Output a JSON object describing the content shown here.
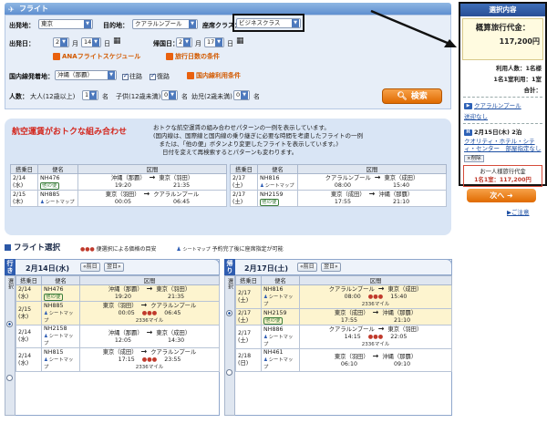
{
  "header": {
    "title": "フライト"
  },
  "search": {
    "departure_label": "出発地：",
    "departure_value": "東京",
    "destination_label": "目的地：",
    "destination_value": "クアラルンプール",
    "class_label": "座席クラス：",
    "class_value": "ビジネスクラス",
    "depart_date_label": "出発日：",
    "depart_month": "2",
    "depart_month_unit": "月",
    "depart_day": "14",
    "depart_day_unit": "日",
    "return_date_label": "帰国日：",
    "return_month": "2",
    "return_month_unit": "月",
    "return_day": "17",
    "return_day_unit": "日",
    "schedule_link": "ANAフライトスケジュール",
    "days_condition_link": "旅行日数の条件",
    "domestic_label": "国内線発着地：",
    "domestic_value": "沖縄（那覇）",
    "outbound_check": "往路",
    "return_check": "復路",
    "domestic_terms_link": "国内線利用条件",
    "people_label": "人数：",
    "adult_label": "大人(12歳以上)",
    "adult_value": "1",
    "adult_unit": "名",
    "child_label": "子供(12歳未満)",
    "child_value": "0",
    "child_unit": "名",
    "infant_label": "幼児(2歳未満)",
    "infant_value": "0",
    "infant_unit": "名",
    "search_button": "検索"
  },
  "deals": {
    "title": "航空運賃がおトクな組み合わせ",
    "desc1": "おトクな航空運賃の組み合わせパターンの一例を表示しています。",
    "desc2": "(国内線は、国際線と国内線の乗り継ぎに必要な時間を考慮したフライトの一例",
    "desc3": "　または、「他の便」ボタンより変更したフライトを表示しています。)",
    "desc4": "日付を変えて再検索するとパターンも変わります。",
    "col_date": "搭乗日",
    "col_flight": "便名",
    "col_route": "区間",
    "other_btn": "他の便",
    "seatmap": "シートマップ",
    "outbound": [
      {
        "date": "2/14",
        "dow": "(水)",
        "flight": "NH476",
        "from": "沖縄（那覇）",
        "dep": "19:20",
        "to": "東京（羽田）",
        "arr": "21:35"
      },
      {
        "date": "2/15",
        "dow": "(木)",
        "flight": "NH885",
        "from": "東京（羽田）",
        "dep": "00:05",
        "to": "クアラルンプール",
        "arr": "06:45"
      }
    ],
    "return": [
      {
        "date": "2/17",
        "dow": "(土)",
        "flight": "NH816",
        "from": "クアラルンプール",
        "dep": "08:00",
        "to": "東京（成田）",
        "arr": "15:40"
      },
      {
        "date": "2/17",
        "dow": "(土)",
        "flight": "NH2159",
        "from": "東京（成田）",
        "dep": "17:55",
        "to": "沖縄（那覇）",
        "arr": "21:10"
      }
    ]
  },
  "flight_select": {
    "title": "フライト選択",
    "legend1": "便選択による価格の目安",
    "legend2": "予約完了後に座席指定が可能",
    "legend2_icon": "シートマップ",
    "col_select": "選択",
    "out_badge": "行き",
    "out_date": "2月14日(水)",
    "ret_badge": "帰り",
    "ret_date": "2月17日(土)",
    "prev_day": "前日",
    "next_day": "翌日",
    "outbound": [
      {
        "selected": true,
        "date": "2/14",
        "dow": "(水)",
        "flight": "NH476",
        "from": "沖縄（那覇）",
        "dep": "19:20",
        "to": "東京（羽田）",
        "arr": "21:35",
        "miles": "",
        "other": true
      },
      {
        "selected": true,
        "date": "2/15",
        "dow": "(木)",
        "flight": "NH885",
        "from": "東京（羽田）",
        "dep": "00:05",
        "to": "クアラルンプール",
        "arr": "06:45",
        "miles": "2336マイル",
        "other": false
      },
      {
        "selected": false,
        "date": "2/14",
        "dow": "(水)",
        "flight": "NH2158",
        "from": "沖縄（那覇）",
        "dep": "12:05",
        "to": "東京（成田）",
        "arr": "14:30",
        "miles": "",
        "other": false
      },
      {
        "selected": false,
        "date": "2/14",
        "dow": "(水)",
        "flight": "NH815",
        "from": "東京（成田）",
        "dep": "17:15",
        "to": "クアラルンプール",
        "arr": "23:55",
        "miles": "2336マイル",
        "other": false
      }
    ],
    "return": [
      {
        "selected": true,
        "date": "2/17",
        "dow": "(土)",
        "flight": "NH816",
        "from": "クアラルンプール",
        "dep": "08:00",
        "to": "東京（成田）",
        "arr": "15:40",
        "miles": "2336マイル",
        "other": false
      },
      {
        "selected": true,
        "date": "2/17",
        "dow": "(土)",
        "flight": "NH2159",
        "from": "東京（成田）",
        "dep": "17:55",
        "to": "沖縄（那覇）",
        "arr": "21:10",
        "miles": "",
        "other": true
      },
      {
        "selected": false,
        "date": "2/17",
        "dow": "(土)",
        "flight": "NH886",
        "from": "クアラルンプール",
        "dep": "14:15",
        "to": "東京（羽田）",
        "arr": "22:05",
        "miles": "2336マイル",
        "other": false
      },
      {
        "selected": false,
        "date": "2/18",
        "dow": "(日)",
        "flight": "NH461",
        "from": "東京（羽田）",
        "dep": "06:10",
        "to": "沖縄（那覇）",
        "arr": "09:10",
        "miles": "",
        "other": false
      }
    ]
  },
  "summary": {
    "heading": "選択内容",
    "fare_label": "概算旅行代金：",
    "fare_value": "117,200円",
    "usage_label": "利用人数：1名様",
    "room_line": "1名1室利用：1室",
    "total_line": "合計：",
    "hotel_city": "クアラルンプール",
    "transfer": "送迎なし",
    "checkin": "2月15日(木) 2泊",
    "hotel_name": "クオリティ・ホテル・シティ・センター　部屋指定なし",
    "delete_btn": "削除",
    "price_label": "お一人様旅行代金",
    "price_value": "1名1室：117,200円",
    "next_button": "次へ",
    "note_link": "ご注意"
  },
  "colors": {
    "accent": "#e06a00",
    "brand": "#2f5db0",
    "highlight": "#fdf4cf"
  }
}
